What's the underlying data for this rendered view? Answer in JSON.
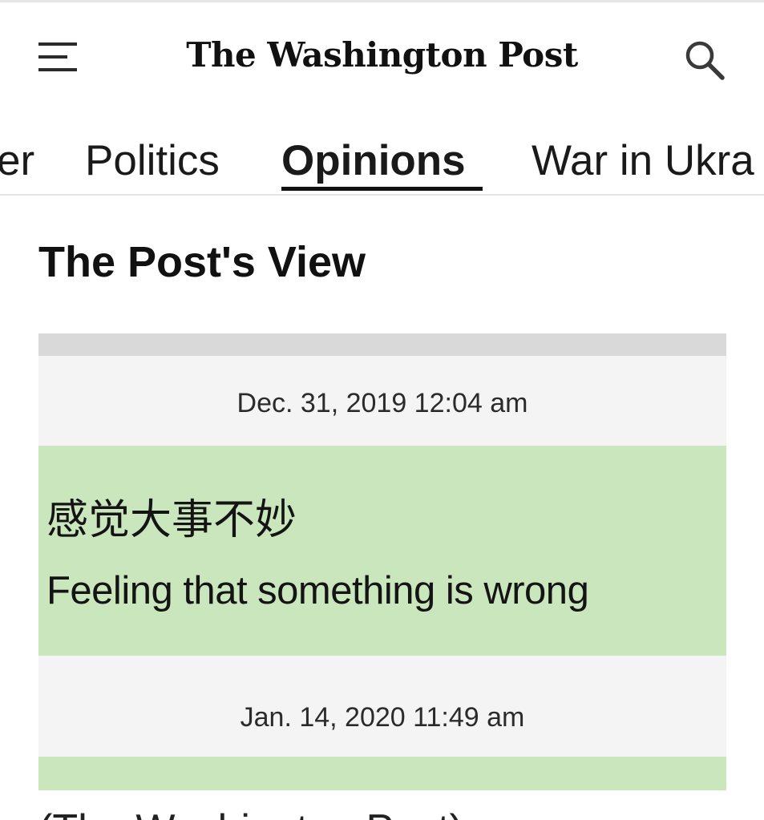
{
  "header": {
    "masthead": "The Washington Post",
    "menu_icon": "hamburger-menu-icon",
    "search_icon": "search-icon"
  },
  "nav": {
    "items": [
      {
        "label": "er"
      },
      {
        "label": "Politics"
      },
      {
        "label": "Opinions",
        "active": true
      },
      {
        "label": "War in Ukra"
      }
    ]
  },
  "section": {
    "title": "The Post's View"
  },
  "figure": {
    "timestamp_1": "Dec. 31, 2019 12:04 am",
    "message_chinese": "感觉大事不妙",
    "message_english": "Feeling that something is wrong",
    "timestamp_2": "Jan. 14, 2020 11:49 am",
    "message_bg_color": "#cae6bd"
  },
  "caption": {
    "text": "(The Washington Post)"
  }
}
